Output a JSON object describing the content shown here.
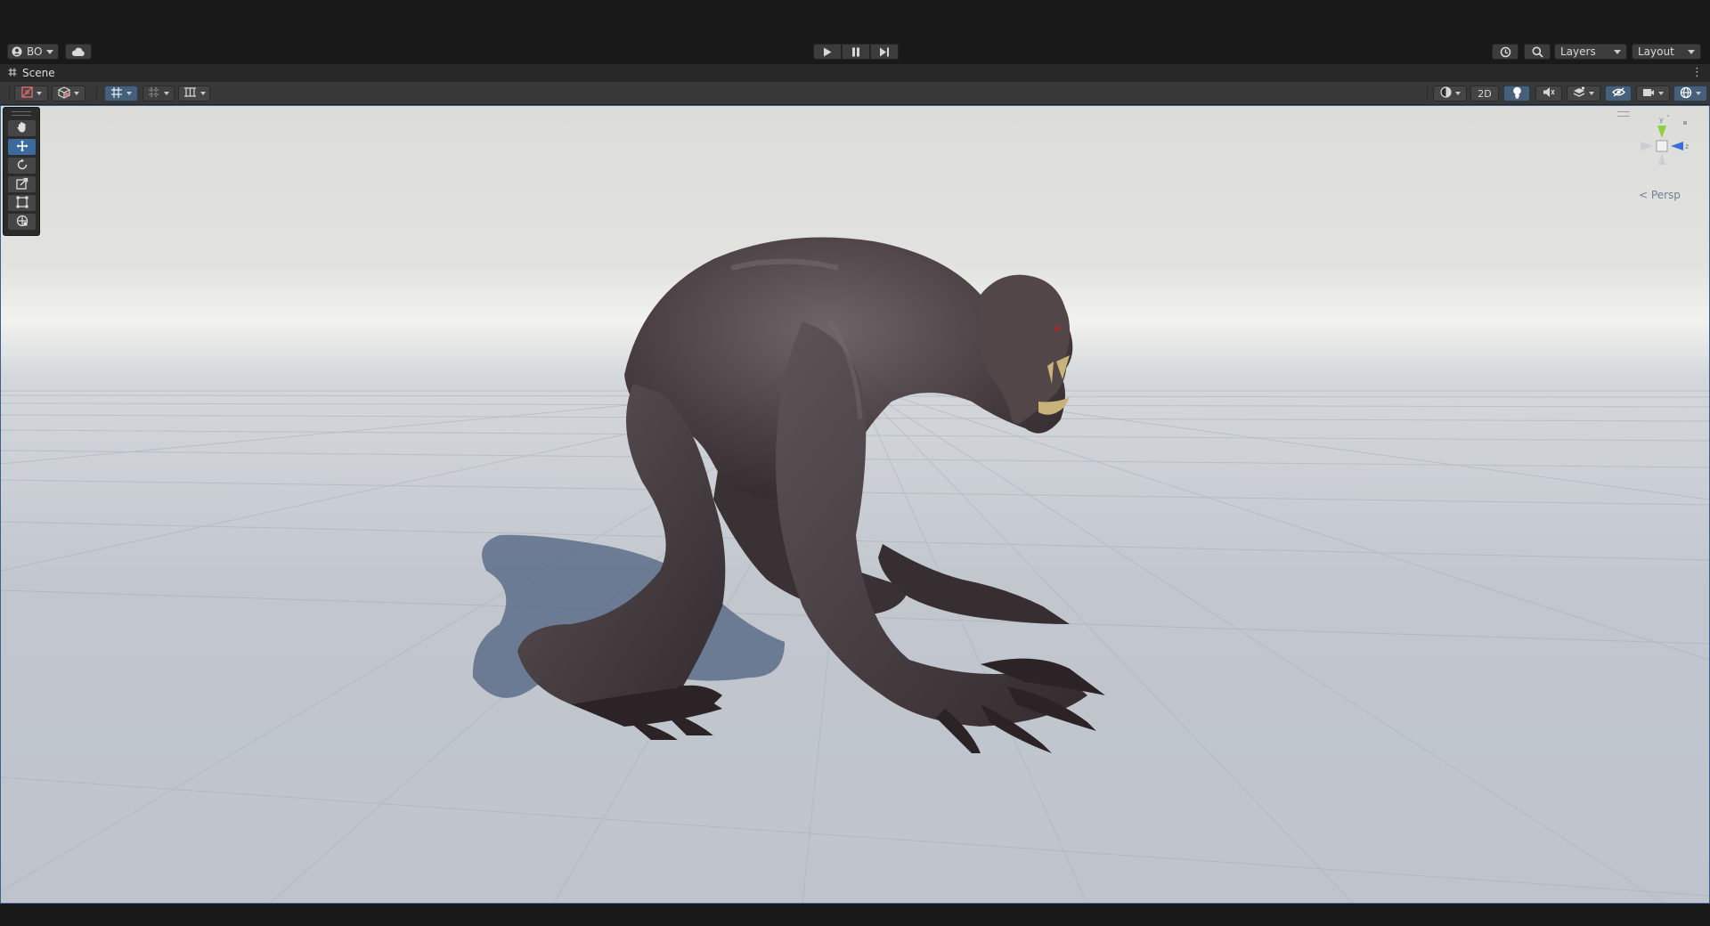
{
  "toolbar": {
    "account_label": "BO",
    "layers_label": "Layers",
    "layout_label": "Layout"
  },
  "scene_tab": {
    "title": "Scene",
    "menu_glyph": "⋮"
  },
  "scene_toolbar": {
    "two_d_label": "2D"
  },
  "tools": [
    "hand-tool",
    "move-tool",
    "rotate-tool",
    "scale-tool",
    "rect-tool",
    "transform-tool"
  ],
  "active_tool": "move-tool",
  "gizmo": {
    "y_label": "y",
    "z_label": "z",
    "persp_label": "Persp"
  },
  "colors": {
    "accent": "#3d6a9c",
    "gizmo_y": "#8fcf3c",
    "gizmo_z": "#3a6ed8",
    "gizmo_x": "#c9cdd4"
  }
}
